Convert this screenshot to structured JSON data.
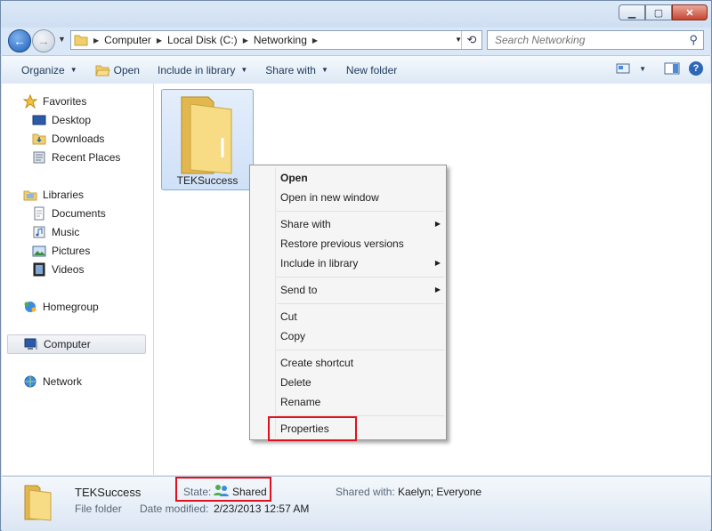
{
  "colors": {
    "accent": "#1e395b",
    "highlight": "#e0101d",
    "folder": "#f0cf6c"
  },
  "window": {
    "minimize": "▁",
    "maximize": "▢",
    "close": "✕"
  },
  "nav": {
    "back_icon": "back-arrow-icon",
    "forward_icon": "forward-arrow-icon",
    "breadcrumb": [
      "Computer",
      "Local Disk (C:)",
      "Networking"
    ],
    "search_placeholder": "Search Networking"
  },
  "toolbar": {
    "organize": "Organize",
    "open": "Open",
    "include_in_library": "Include in library",
    "share_with": "Share with",
    "new_folder": "New folder"
  },
  "sidebar": {
    "favorites": "Favorites",
    "desktop": "Desktop",
    "downloads": "Downloads",
    "recent_places": "Recent Places",
    "libraries": "Libraries",
    "documents": "Documents",
    "music": "Music",
    "pictures": "Pictures",
    "videos": "Videos",
    "homegroup": "Homegroup",
    "computer": "Computer",
    "network": "Network"
  },
  "content": {
    "folder_name": "TEKSuccess"
  },
  "context_menu": {
    "open": "Open",
    "open_new_window": "Open in new window",
    "share_with": "Share with",
    "restore_previous": "Restore previous versions",
    "include_in_library": "Include in library",
    "send_to": "Send to",
    "cut": "Cut",
    "copy": "Copy",
    "create_shortcut": "Create shortcut",
    "delete": "Delete",
    "rename": "Rename",
    "properties": "Properties"
  },
  "details": {
    "name": "TEKSuccess",
    "type": "File folder",
    "state_label": "State:",
    "state_value": "Shared",
    "date_label": "Date modified:",
    "date_value": "2/23/2013 12:57 AM",
    "shared_with_label": "Shared with:",
    "shared_with_value": "Kaelyn; Everyone"
  }
}
